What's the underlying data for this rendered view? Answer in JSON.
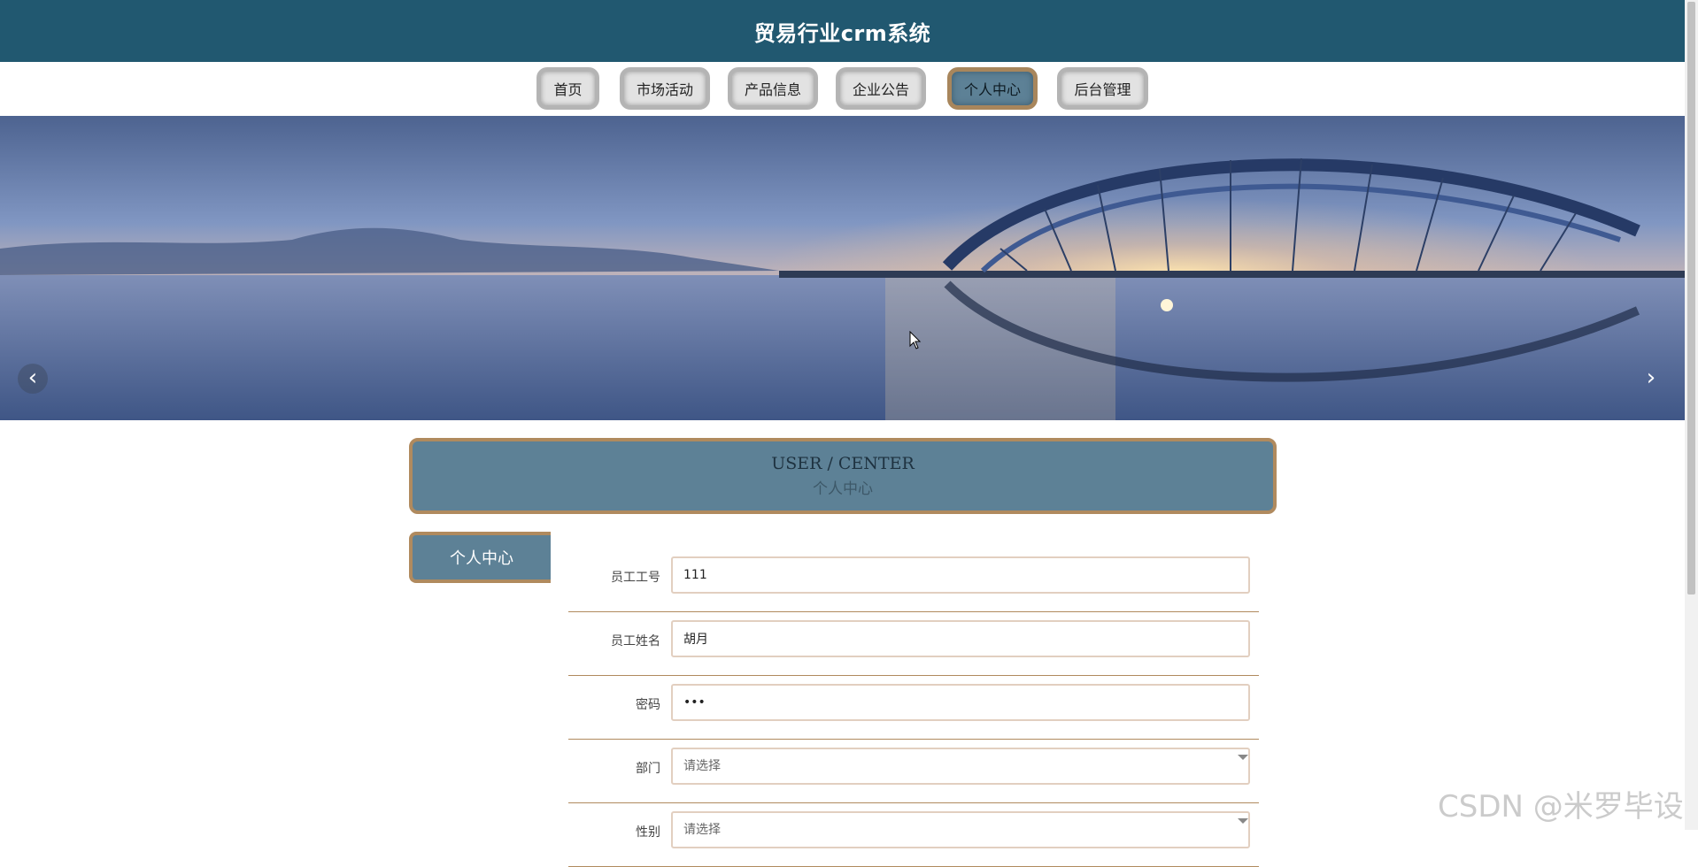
{
  "app": {
    "title": "贸易行业crm系统"
  },
  "nav": {
    "items": [
      {
        "label": "首页"
      },
      {
        "label": "市场活动"
      },
      {
        "label": "产品信息"
      },
      {
        "label": "企业公告"
      },
      {
        "label": "个人中心"
      },
      {
        "label": "后台管理"
      }
    ],
    "active": "个人中心"
  },
  "banner": {
    "prev_icon": "chevron-left-icon",
    "next_icon": "chevron-right-icon",
    "prev_glyph": "‹",
    "next_glyph": "›"
  },
  "section": {
    "title_en": "USER / CENTER",
    "title_zh": "个人中心"
  },
  "sidebar": {
    "tab_label": "个人中心"
  },
  "form": {
    "employee_id": {
      "label": "员工工号",
      "value": "111"
    },
    "employee_name": {
      "label": "员工姓名",
      "value": "胡月"
    },
    "password": {
      "label": "密码",
      "value": "•••"
    },
    "department": {
      "label": "部门",
      "placeholder": "请选择"
    },
    "gender": {
      "label": "性别",
      "placeholder": "请选择"
    }
  },
  "watermark": "CSDN @米罗毕设",
  "colors": {
    "header": "#215870",
    "accent": "#5d8196",
    "border": "#b08a5e"
  }
}
